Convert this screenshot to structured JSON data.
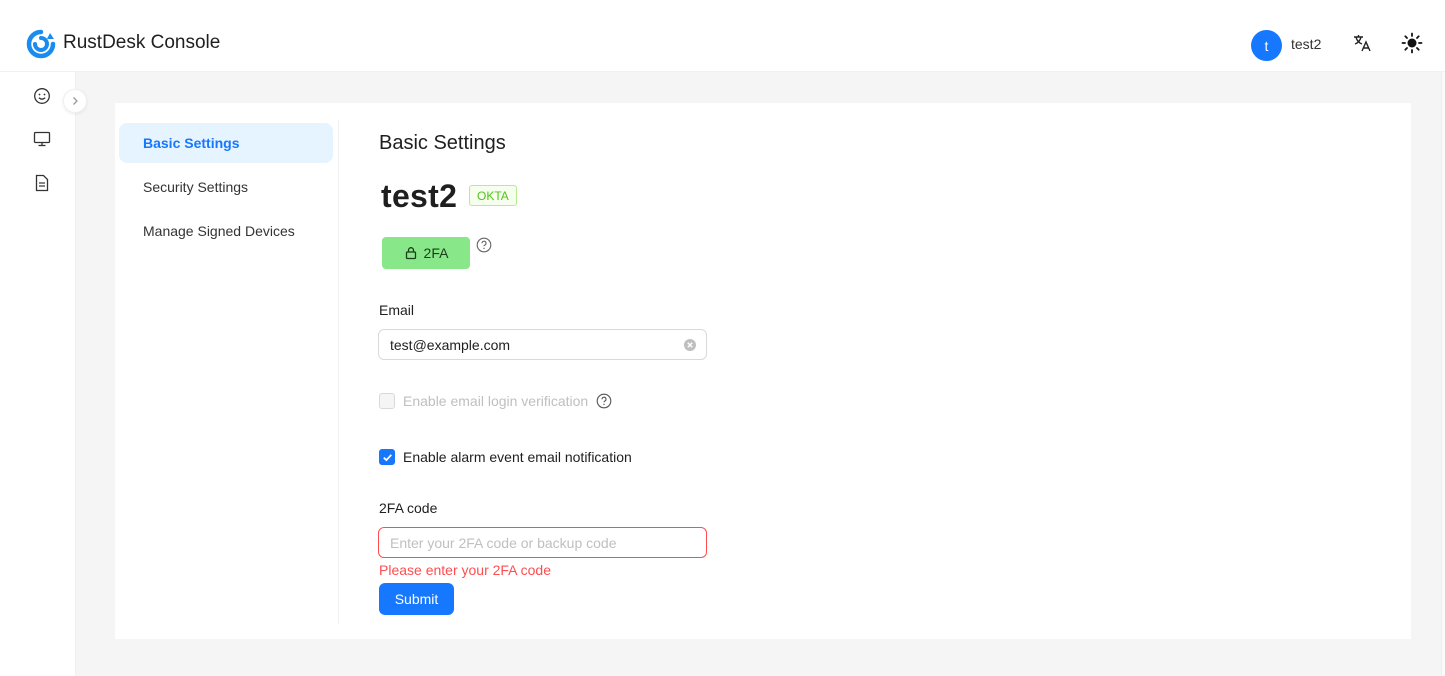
{
  "app": {
    "title": "RustDesk Console",
    "logo_icon": "rustdesk-logo-icon"
  },
  "header": {
    "avatar_letter": "t",
    "username": "test2",
    "translate_icon": "translate-icon",
    "theme_icon": "sun-icon"
  },
  "leftbar": {
    "icons": [
      "smiley-icon",
      "monitor-icon",
      "document-icon"
    ],
    "collapse_icon": "chevron-right-icon"
  },
  "settings_menu": {
    "items": [
      {
        "label": "Basic Settings",
        "active": true
      },
      {
        "label": "Security Settings",
        "active": false
      },
      {
        "label": "Manage Signed Devices",
        "active": false
      }
    ]
  },
  "main": {
    "section_title": "Basic Settings",
    "user_name": "test2",
    "provider_tag": "OKTA",
    "twofa_button": "2FA",
    "email_label": "Email",
    "email_value": "test@example.com",
    "email_login_verification": {
      "label": "Enable email login verification",
      "checked": false,
      "disabled": true
    },
    "alarm_notification": {
      "label": "Enable alarm event email notification",
      "checked": true,
      "disabled": false
    },
    "twofa_code_label": "2FA code",
    "twofa_code_placeholder": "Enter your 2FA code or backup code",
    "twofa_code_error": "Please enter your 2FA code",
    "submit_label": "Submit"
  },
  "colors": {
    "accent": "#1677ff",
    "error": "#ff4d4f",
    "twofa_green": "#88e788",
    "okta_green": "#52c41a"
  }
}
